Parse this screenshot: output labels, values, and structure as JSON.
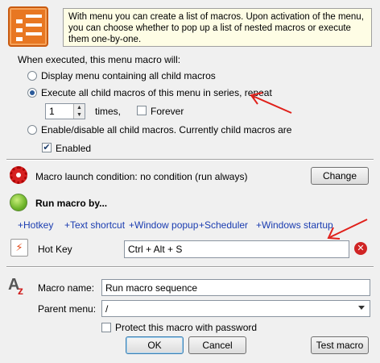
{
  "info": {
    "text": "With menu you can create a list of macros. Upon activation of the menu, you can choose whether to pop up a list of nested macros or execute them one-by-one."
  },
  "execution": {
    "heading": "When executed, this menu macro will:",
    "option_display": "Display menu containing all child macros",
    "option_series": "Execute all child macros of this menu in series, repeat",
    "repeat_value": "1",
    "times_label": "times,",
    "forever_label": "Forever",
    "option_enable": "Enable/disable all child macros. Currently child macros are",
    "enabled_label": "Enabled"
  },
  "launch": {
    "condition_text": "Macro launch condition: no condition (run always)",
    "change_label": "Change"
  },
  "run_by": {
    "title": "Run macro by...",
    "links": [
      "+Hotkey",
      "+Text shortcut",
      "+Window popup",
      "+Scheduler",
      "+Windows startup"
    ]
  },
  "hotkey": {
    "label": "Hot Key",
    "value": "Ctrl + Alt + S"
  },
  "macro": {
    "name_label": "Macro name:",
    "name_value": "Run macro sequence",
    "parent_label": "Parent menu:",
    "parent_value": "/",
    "protect_label": "Protect this macro with password"
  },
  "buttons": {
    "ok": "OK",
    "cancel": "Cancel",
    "test": "Test macro"
  },
  "colors": {
    "annotation_arrow": "#e0201a",
    "link": "#1a3cb0"
  }
}
